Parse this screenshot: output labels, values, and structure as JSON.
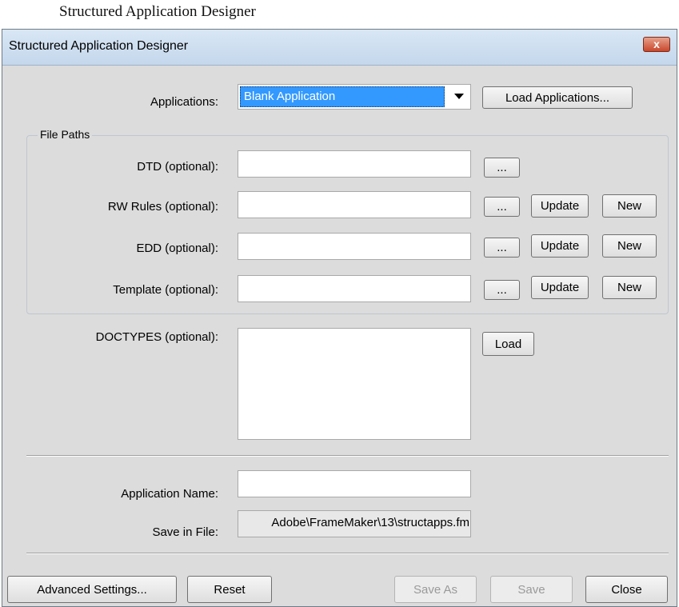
{
  "page_caption": "Structured Application Designer",
  "window": {
    "title": "Structured Application Designer",
    "close_glyph": "x"
  },
  "applications": {
    "label": "Applications:",
    "selected": "Blank Application",
    "load_button": "Load Applications..."
  },
  "file_paths": {
    "group_label": "File Paths",
    "rows": [
      {
        "label": "DTD (optional):",
        "value": "",
        "browse": "...",
        "update": null,
        "new": null
      },
      {
        "label": "RW Rules (optional):",
        "value": "",
        "browse": "...",
        "update": "Update",
        "new": "New"
      },
      {
        "label": "EDD (optional):",
        "value": "",
        "browse": "...",
        "update": "Update",
        "new": "New"
      },
      {
        "label": "Template (optional):",
        "value": "",
        "browse": "...",
        "update": "Update",
        "new": "New"
      }
    ]
  },
  "doctypes": {
    "label": "DOCTYPES (optional):",
    "value": "",
    "load_button": "Load"
  },
  "app_name": {
    "label": "Application Name:",
    "value": ""
  },
  "save_in_file": {
    "label": "Save in File:",
    "value": "Adobe\\FrameMaker\\13\\structapps.fm"
  },
  "footer": {
    "advanced": "Advanced Settings...",
    "reset": "Reset",
    "save_as": "Save As",
    "save": "Save",
    "close": "Close"
  },
  "icons": {
    "dropdown": "chevron-down-icon",
    "close": "close-icon"
  },
  "colors": {
    "selection": "#3399ff",
    "close_button": "#c9472c"
  }
}
